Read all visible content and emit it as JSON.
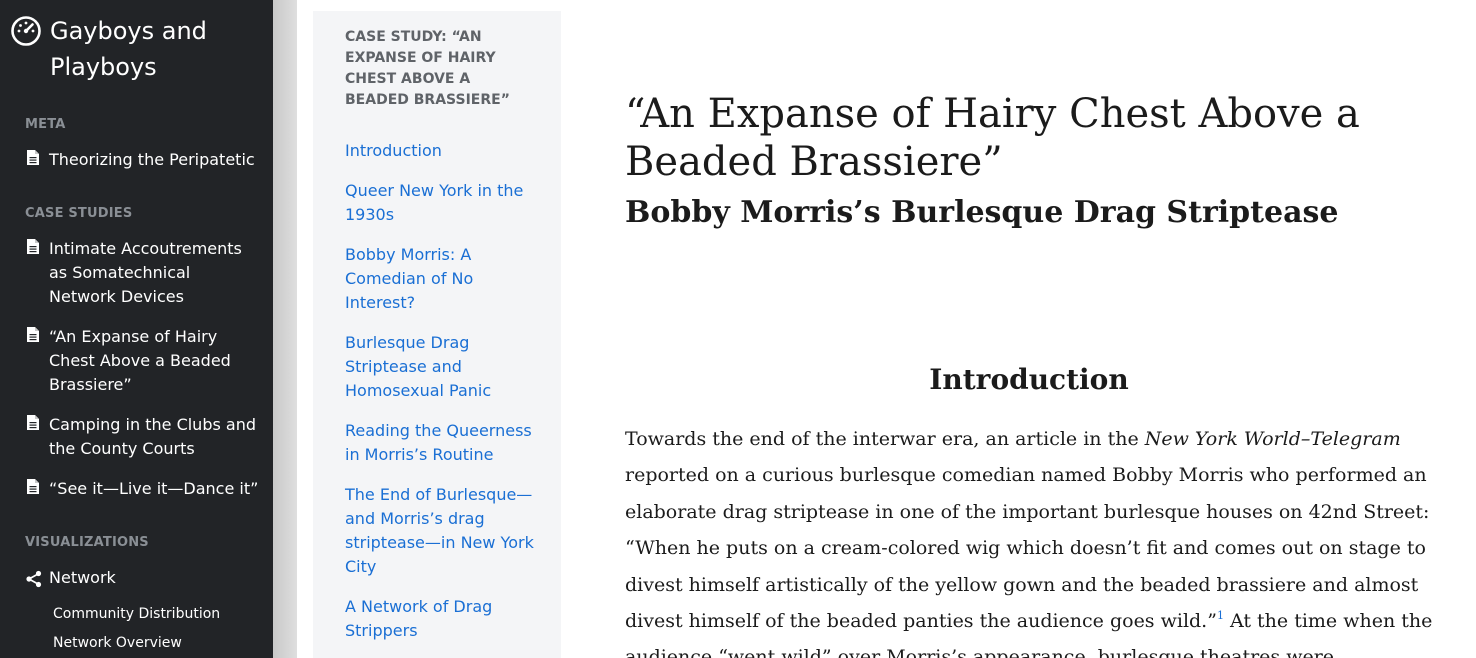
{
  "sidebar": {
    "brand": {
      "icon": "dashboard-gauge-icon",
      "title": "Gayboys and Playboys"
    },
    "sections": {
      "meta": {
        "label": "META",
        "items": [
          {
            "label": "Theorizing the Peripatetic",
            "icon": "document-icon"
          }
        ]
      },
      "case_studies": {
        "label": "CASE STUDIES",
        "items": [
          {
            "label": "Intimate Accoutrements as Somatechnical Network Devices",
            "icon": "document-icon"
          },
          {
            "label": "“An Expanse of Hairy Chest Above a Beaded Brassiere”",
            "icon": "document-icon"
          },
          {
            "label": "Camping in the Clubs and the County Courts",
            "icon": "document-icon"
          },
          {
            "label": "“See it—Live it—Dance it”",
            "icon": "document-icon"
          }
        ]
      },
      "visualizations": {
        "label": "VISUALIZATIONS",
        "items": [
          {
            "label": "Network",
            "icon": "share-network-icon"
          }
        ],
        "subitems": [
          "Community Distribution",
          "Network Overview"
        ]
      }
    }
  },
  "toc": {
    "heading": "CASE STUDY: “AN EXPANSE OF HAIRY CHEST ABOVE A BEADED BRASSIERE”",
    "links": [
      "Introduction",
      "Queer New York in the 1930s",
      "Bobby Morris: A Comedian of No Interest?",
      "Burlesque Drag Striptease and Homosexual Panic",
      "Reading the Queerness in Morris’s Routine",
      "The End of Burlesque—and Morris’s drag striptease—in New York City",
      "A Network of Drag Strippers"
    ]
  },
  "article": {
    "title": "“An Expanse of Hairy Chest Above a Beaded Brassiere”",
    "subtitle": "Bobby Morris’s Burlesque Drag Striptease",
    "section_title": "Introduction",
    "paragraph": {
      "part1": "Towards the end of the interwar era, an article in the ",
      "publication": "New York World–Telegram",
      "part2": " reported on a curious burlesque comedian named Bobby Morris who performed an elaborate drag striptease in one of the important burlesque houses on 42nd Street: “When he puts on a cream-colored wig which doesn’t fit and comes out on stage to divest himself artistically of the yellow gown and the beaded brassiere and almost divest himself of the beaded panties the audience goes wild.”",
      "footnote": "1",
      "part3": " At the time when the audience “went wild” over Morris’s appearance, burlesque theatres were"
    }
  },
  "colors": {
    "sidebar_bg": "#222427",
    "toc_bg": "#f4f5f7",
    "link": "#1a6fd4",
    "section_label": "#8a8f95"
  }
}
